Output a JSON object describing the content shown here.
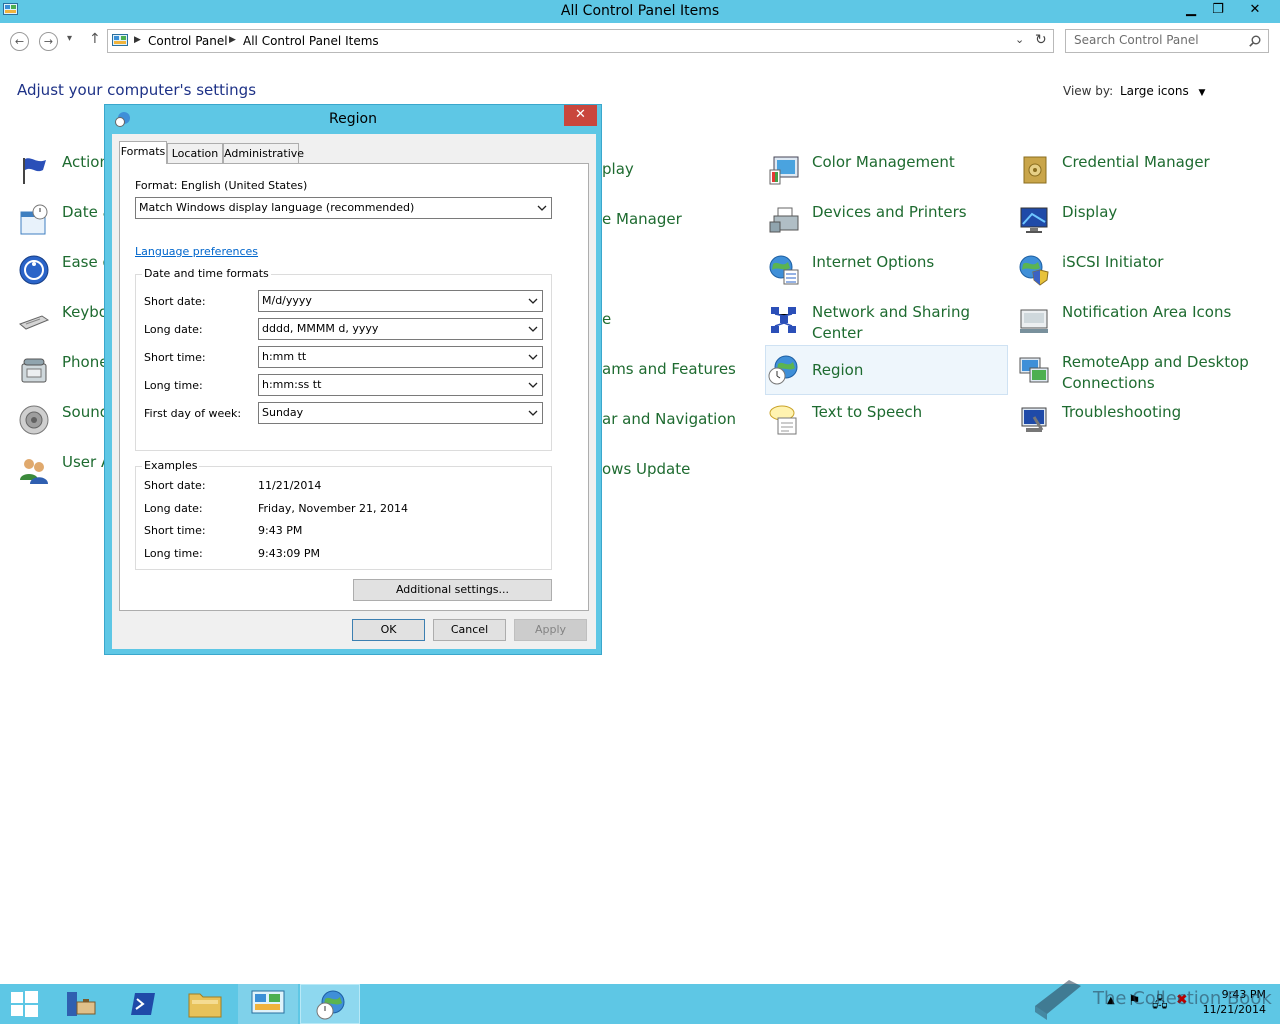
{
  "window": {
    "title": "All Control Panel Items",
    "minimize": "▁",
    "restore": "❐",
    "close": "✕"
  },
  "nav": {
    "back": "←",
    "forward": "→",
    "recent": "▾",
    "up": "↑",
    "breadcrumbs": [
      "Control Panel",
      "All Control Panel Items"
    ],
    "search_placeholder": "Search Control Panel"
  },
  "page": {
    "title": "Adjust your computer's settings",
    "view_by_label": "View by:",
    "view_by_value": "Large icons"
  },
  "items": {
    "col1": [
      "Action",
      "Date a",
      "Ease o",
      "Keybo",
      "Phone",
      "Sound",
      "User A"
    ],
    "col2": [
      "play",
      "e Manager",
      "e",
      "ams and Features",
      "ar and Navigation",
      "ows Update"
    ],
    "col3": [
      "Color Management",
      "Devices and Printers",
      "Internet Options",
      "Network and Sharing",
      "Center",
      "Region",
      "Text to Speech"
    ],
    "col4": [
      "Credential Manager",
      "Display",
      "iSCSI Initiator",
      "Notification Area Icons",
      "RemoteApp and Desktop",
      "Connections",
      "Troubleshooting"
    ]
  },
  "dialog": {
    "title": "Region",
    "close": "✕",
    "tabs": [
      "Formats",
      "Location",
      "Administrative"
    ],
    "format_label": "Format: English (United States)",
    "format_value": "Match Windows display language (recommended)",
    "language_link": "Language preferences",
    "dt_group_title": "Date and time formats",
    "fields": [
      {
        "label": "Short date:",
        "value": "M/d/yyyy"
      },
      {
        "label": "Long date:",
        "value": "dddd, MMMM d, yyyy"
      },
      {
        "label": "Short time:",
        "value": "h:mm tt"
      },
      {
        "label": "Long time:",
        "value": "h:mm:ss tt"
      },
      {
        "label": "First day of week:",
        "value": "Sunday"
      }
    ],
    "examples_title": "Examples",
    "examples": [
      {
        "label": "Short date:",
        "value": "11/21/2014"
      },
      {
        "label": "Long date:",
        "value": "Friday, November 21, 2014"
      },
      {
        "label": "Short time:",
        "value": "9:43 PM"
      },
      {
        "label": "Long time:",
        "value": "9:43:09 PM"
      }
    ],
    "additional_button": "Additional settings...",
    "ok": "OK",
    "cancel": "Cancel",
    "apply": "Apply"
  },
  "taskbar": {
    "time": "9:43 PM",
    "date": "11/21/2014"
  },
  "watermark": "The Collection Book",
  "colors": {
    "chrome": "#5ec7e5",
    "link_green": "#1e6b30",
    "title_blue": "#1e3287",
    "close_red": "#c9463d"
  }
}
